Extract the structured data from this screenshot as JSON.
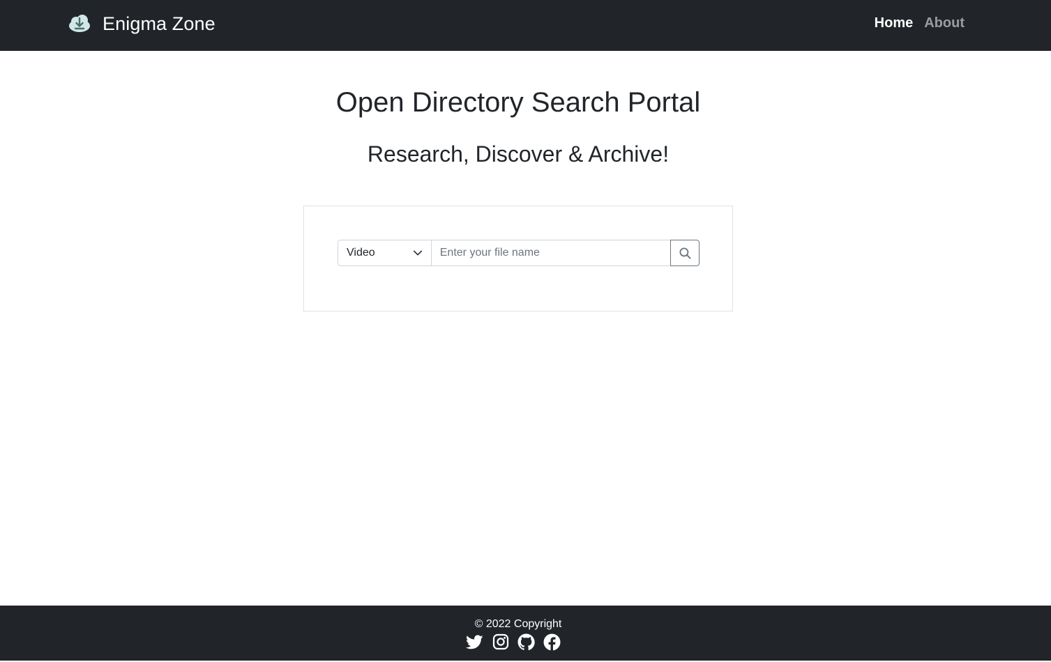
{
  "navbar": {
    "brand": "Enigma Zone",
    "brand_icon": "cloud-download-icon",
    "links": [
      {
        "label": "Home",
        "active": true
      },
      {
        "label": "About",
        "active": false
      }
    ]
  },
  "hero": {
    "title": "Open Directory Search Portal",
    "subtitle": "Research, Discover & Archive!"
  },
  "search": {
    "type_selected": "Video",
    "input_value": "",
    "input_placeholder": "Enter your file name",
    "button_icon": "search-icon"
  },
  "footer": {
    "copyright": "© 2022 Copyright",
    "social": [
      "twitter-icon",
      "instagram-icon",
      "github-icon",
      "facebook-icon"
    ]
  },
  "colors": {
    "navbar_bg": "#212529",
    "footer_bg": "#212529",
    "text": "#212529",
    "nav_inactive": "#8c8e91"
  }
}
